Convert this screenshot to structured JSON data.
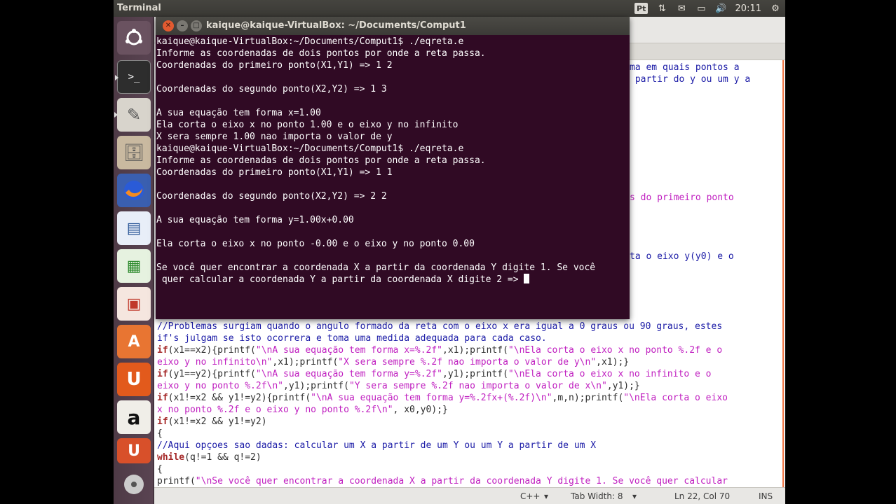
{
  "panel": {
    "title": "Terminal",
    "kbd_indicator": "Pt",
    "clock": "20:11"
  },
  "launcher": {
    "items": [
      {
        "name": "dash-home",
        "icon": "ubuntu-logo-icon"
      },
      {
        "name": "terminal",
        "icon": "terminal-icon"
      },
      {
        "name": "text-editor",
        "icon": "text-editor-icon"
      },
      {
        "name": "file-manager",
        "icon": "file-cabinet-icon"
      },
      {
        "name": "firefox",
        "icon": "firefox-icon"
      },
      {
        "name": "libreoffice-writer",
        "icon": "writer-icon"
      },
      {
        "name": "libreoffice-calc",
        "icon": "calc-icon"
      },
      {
        "name": "libreoffice-impress",
        "icon": "impress-icon"
      },
      {
        "name": "software-center",
        "icon": "software-center-icon"
      },
      {
        "name": "ubuntu-one",
        "icon": "ubuntu-one-icon"
      },
      {
        "name": "amazon",
        "icon": "amazon-icon"
      },
      {
        "name": "ubuntu-one-music",
        "icon": "ubuntu-one-music-icon"
      },
      {
        "name": "optical-drive",
        "icon": "disc-icon"
      }
    ]
  },
  "terminal": {
    "title": "kaique@kaique-VirtualBox: ~/Documents/Comput1",
    "lines": [
      "kaique@kaique-VirtualBox:~/Documents/Comput1$ ./eqreta.e",
      "Informe as coordenadas de dois pontos por onde a reta passa.",
      "Coordenadas do primeiro ponto(X1,Y1) => 1 2",
      "",
      "Coordenadas do segundo ponto(X2,Y2) => 1 3",
      "",
      "A sua equação tem forma x=1.00",
      "Ela corta o eixo x no ponto 1.00 e o eixo y no infinito",
      "X sera sempre 1.00 nao importa o valor de y",
      "kaique@kaique-VirtualBox:~/Documents/Comput1$ ./eqreta.e",
      "Informe as coordenadas de dois pontos por onde a reta passa.",
      "Coordenadas do primeiro ponto(X1,Y1) => 1 1",
      "",
      "Coordenadas do segundo ponto(X2,Y2) => 2 2",
      "",
      "A sua equação tem forma y=1.00x+0.00",
      "",
      "Ela corta o eixo x no ponto -0.00 e o eixo y no ponto 0.00",
      "",
      "Se você quer encontrar a coordenada X a partir da coordenada Y digite 1. Se você",
      " quer calcular a coordenada Y a partir da coordenada X digite 2 => "
    ]
  },
  "editor": {
    "visible_right": [
      "ma em quais pontos a",
      " partir do y ou um y a",
      "s do primeiro ponto",
      "ta o eixo y(y0) e o"
    ],
    "code": [
      {
        "cls": "c-comment",
        "text": "//Problemas surgiam quando o angulo formado da reta com o eixo x era igual a 0 graus ou 90 graus, estes"
      },
      {
        "cls": "c-comment",
        "text": "if's julgam se isto ocorrera e toma uma medida adequada para cada caso."
      },
      {
        "cls": "mix",
        "parts": [
          [
            "c-kw",
            "if"
          ],
          [
            "c-plain",
            "(x1==x2){printf("
          ],
          [
            "c-str",
            "\"\\nA sua equação tem forma x=%.2f\""
          ],
          [
            "c-plain",
            ",x1);printf("
          ],
          [
            "c-str",
            "\"\\nEla corta o eixo x no ponto %.2f e o"
          ]
        ]
      },
      {
        "cls": "mix",
        "parts": [
          [
            "c-str",
            "eixo y no infinito\\n\""
          ],
          [
            "c-plain",
            ",x1);printf("
          ],
          [
            "c-str",
            "\"X sera sempre %.2f nao importa o valor de y\\n\""
          ],
          [
            "c-plain",
            ",x1);}"
          ]
        ]
      },
      {
        "cls": "mix",
        "parts": [
          [
            "c-kw",
            "if"
          ],
          [
            "c-plain",
            "(y1==y2){printf("
          ],
          [
            "c-str",
            "\"\\nA sua equação tem forma y=%.2f\""
          ],
          [
            "c-plain",
            ",y1);printf("
          ],
          [
            "c-str",
            "\"\\nEla corta o eixo x no infinito e o"
          ]
        ]
      },
      {
        "cls": "mix",
        "parts": [
          [
            "c-str",
            "eixo y no ponto %.2f\\n\""
          ],
          [
            "c-plain",
            ",y1);printf("
          ],
          [
            "c-str",
            "\"Y sera sempre %.2f nao importa o valor de x\\n\""
          ],
          [
            "c-plain",
            ",y1);}"
          ]
        ]
      },
      {
        "cls": "mix",
        "parts": [
          [
            "c-kw",
            "if"
          ],
          [
            "c-plain",
            "(x1!=x2 && y1!=y2){printf("
          ],
          [
            "c-str",
            "\"\\nA sua equação tem forma y=%.2fx+(%.2f)\\n\""
          ],
          [
            "c-plain",
            ",m,n);printf("
          ],
          [
            "c-str",
            "\"\\nEla corta o eixo"
          ]
        ]
      },
      {
        "cls": "mix",
        "parts": [
          [
            "c-str",
            "x no ponto %.2f e o eixo y no ponto %.2f\\n\""
          ],
          [
            "c-plain",
            ", x0,y0);}"
          ]
        ]
      },
      {
        "cls": "mix",
        "parts": [
          [
            "c-kw",
            "if"
          ],
          [
            "c-plain",
            "(x1!=x2 && y1!=y2)"
          ]
        ]
      },
      {
        "cls": "c-plain",
        "text": "{"
      },
      {
        "cls": "c-comment",
        "text": "//Aqui opçoes sao dadas: calcular um X a partir de um Y ou um Y a partir de um X"
      },
      {
        "cls": "mix",
        "parts": [
          [
            "c-kw",
            "while"
          ],
          [
            "c-plain",
            "(q!=1 && q!=2)"
          ]
        ]
      },
      {
        "cls": "c-plain",
        "text": "{"
      },
      {
        "cls": "mix",
        "parts": [
          [
            "c-plain",
            "printf("
          ],
          [
            "c-str",
            "\"\\nSe você quer encontrar a coordenada X a partir da coordenada Y digite 1. Se você quer calcular"
          ]
        ]
      }
    ]
  },
  "statusbar": {
    "language": "C++",
    "tab_width": "Tab Width:  8",
    "position": "Ln 22, Col 70",
    "mode": "INS"
  }
}
